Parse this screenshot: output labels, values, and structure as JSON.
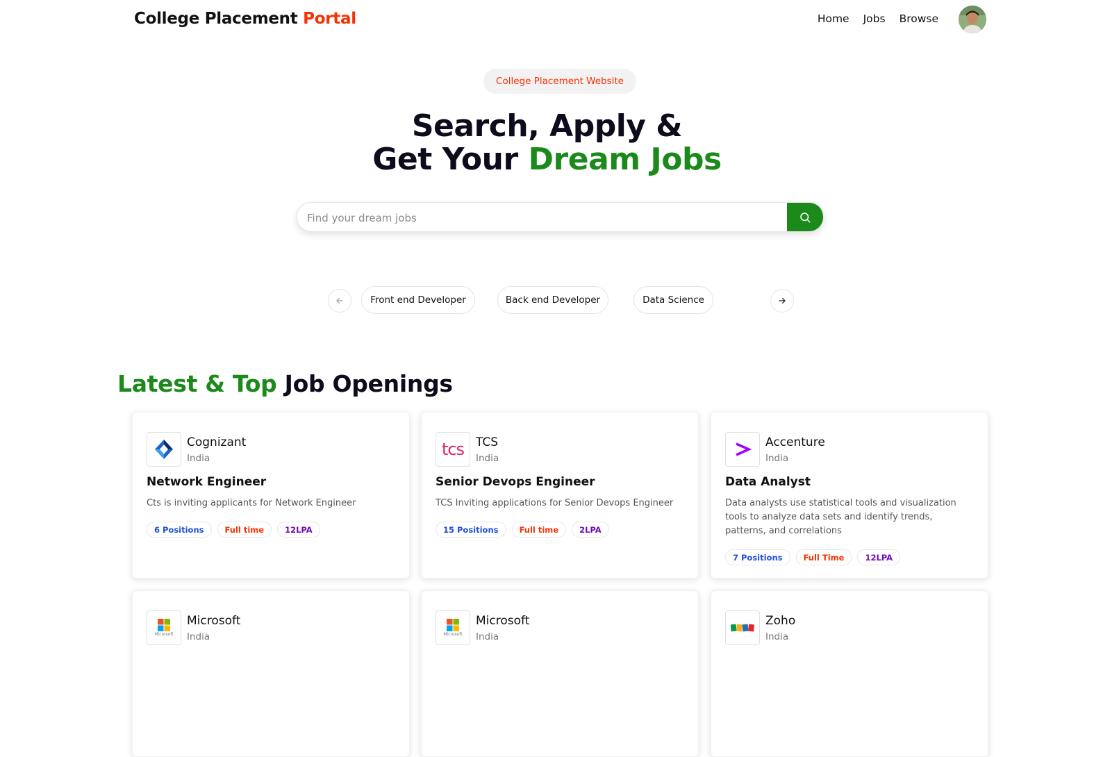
{
  "navbar": {
    "brand_main": "College Placement",
    "brand_accent": "Portal",
    "links": [
      "Home",
      "Jobs",
      "Browse"
    ]
  },
  "hero": {
    "tagline": "College Placement Website",
    "headline_line1": "Search, Apply &",
    "headline_line2_prefix": "Get Your",
    "headline_line2_accent": "Dream Jobs",
    "search_placeholder": "Find your dream jobs"
  },
  "categories": [
    "Front end Developer",
    "Back end Developer",
    "Data Science"
  ],
  "section": {
    "title_accent": "Latest & Top",
    "title_rest": "Job Openings"
  },
  "jobs": [
    {
      "company": "Cognizant",
      "location": "India",
      "title": "Network Engineer",
      "description": "Cts is inviting applicants for Network Engineer",
      "positions": "6 Positions",
      "type": "Full time",
      "salary": "12LPA"
    },
    {
      "company": "TCS",
      "location": "India",
      "title": "Senior Devops Engineer",
      "description": "TCS Inviting applications for Senior Devops Engineer",
      "positions": "15 Positions",
      "type": "Full time",
      "salary": "2LPA"
    },
    {
      "company": "Accenture",
      "location": "India",
      "title": "Data Analyst",
      "description": "Data analysts use statistical tools and visualization tools to analyze data sets and identify trends, patterns, and correlations",
      "positions": "7 Positions",
      "type": "Full Time",
      "salary": "12LPA"
    },
    {
      "company": "Microsoft",
      "location": "India"
    },
    {
      "company": "Microsoft",
      "location": "India"
    },
    {
      "company": "Zoho",
      "location": "India"
    }
  ],
  "logo_text": {
    "tcs": "tcs",
    "microsoft": "Microsoft"
  },
  "colors": {
    "brand_red": "#F83002",
    "brand_green": "#1b8a1b",
    "badge_blue": "#1d4ed8",
    "badge_purple": "#7209b7"
  }
}
